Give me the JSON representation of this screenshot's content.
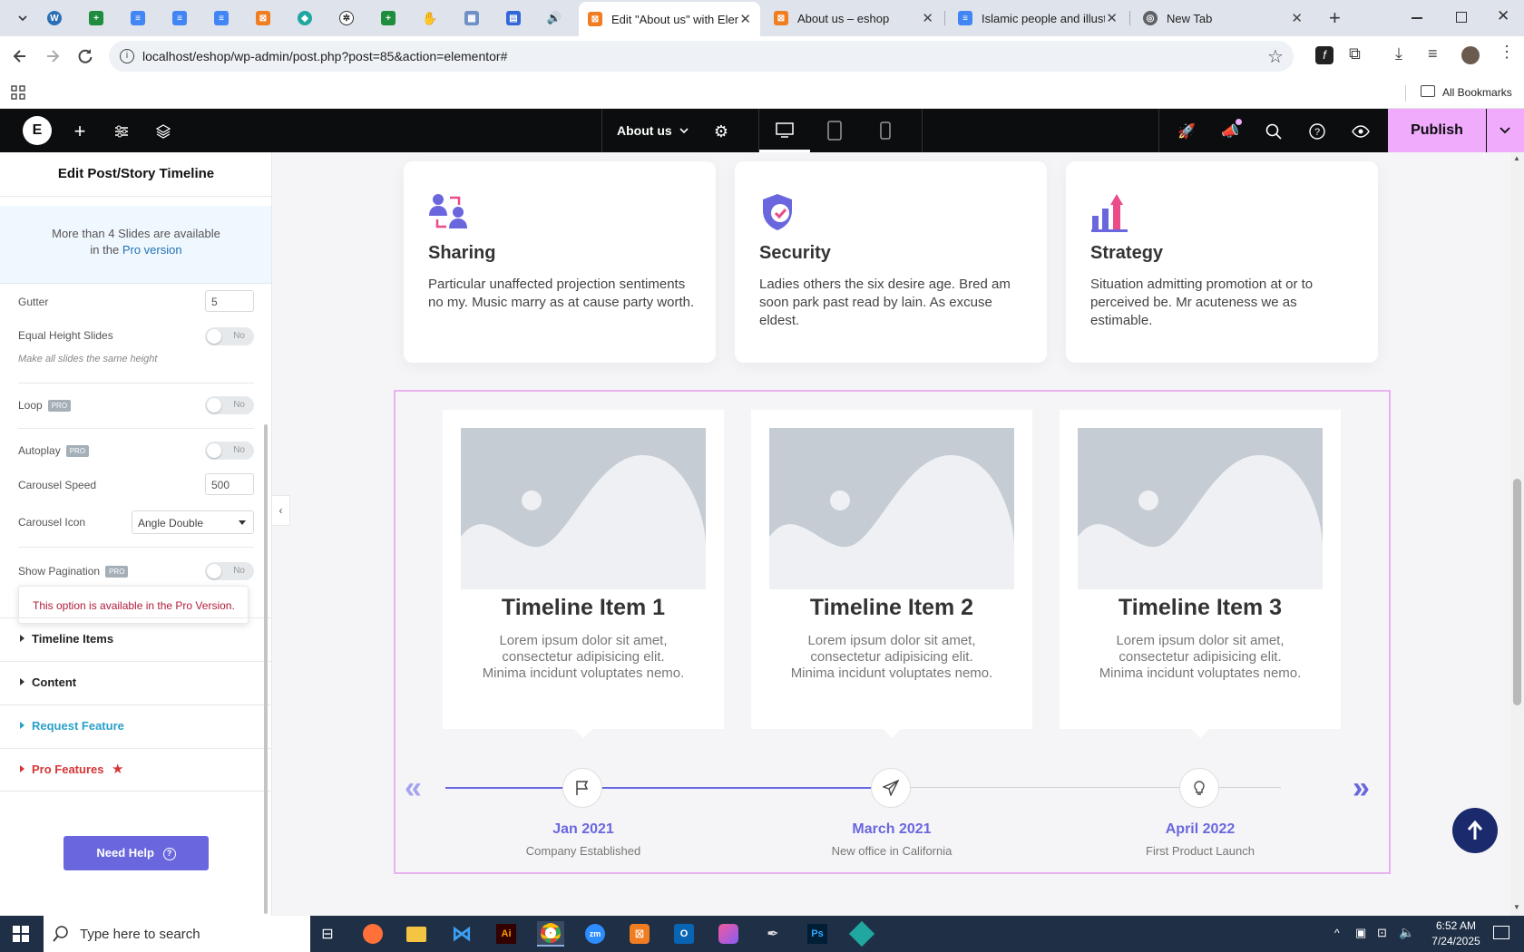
{
  "browser": {
    "tabs": [
      {
        "title": "Edit \"About us\" with Elem",
        "active": true
      },
      {
        "title": "About us – eshop",
        "active": false
      },
      {
        "title": "Islamic people and illustr",
        "active": false
      },
      {
        "title": "New Tab",
        "active": false
      }
    ],
    "url": "localhost/eshop/wp-admin/post.php?post=85&action=elementor#",
    "bookmarks_label": "All Bookmarks"
  },
  "elementor": {
    "page_name": "About us",
    "publish_label": "Publish"
  },
  "panel": {
    "title": "Edit Post/Story Timeline",
    "promo_line1": "More than 4 Slides are available",
    "promo_line2_prefix": "in the",
    "promo_link": "Pro version",
    "gutter_label": "Gutter",
    "gutter_value": "5",
    "equal_height_label": "Equal Height Slides",
    "equal_height_value": "No",
    "equal_height_hint": "Make all slides the same height",
    "loop_label": "Loop",
    "loop_value": "No",
    "autoplay_label": "Autoplay",
    "autoplay_value": "No",
    "pro_badge": "PRO",
    "speed_label": "Carousel Speed",
    "speed_value": "500",
    "icon_label": "Carousel Icon",
    "icon_value": "Angle Double",
    "pagination_label": "Show Pagination",
    "pagination_value": "No",
    "tooltip": "This option is available in the Pro Version.",
    "sections": [
      "Timeline Items",
      "Content",
      "Request Feature",
      "Pro Features"
    ],
    "help_label": "Need Help"
  },
  "features": [
    {
      "title": "Sharing",
      "desc": "Particular unaffected projection sentiments no my. Music marry as at cause party worth."
    },
    {
      "title": "Security",
      "desc": "Ladies others the six desire age. Bred am soon park past read by lain. As excuse eldest."
    },
    {
      "title": "Strategy",
      "desc": "Situation admitting promotion at or to perceived be. Mr acuteness we as estimable."
    }
  ],
  "timeline": [
    {
      "title": "Timeline Item 1",
      "desc": "Lorem ipsum dolor sit amet, consectetur adipisicing elit. Minima incidunt voluptates nemo.",
      "date": "Jan 2021",
      "sub": "Company Established"
    },
    {
      "title": "Timeline Item 2",
      "desc": "Lorem ipsum dolor sit amet, consectetur adipisicing elit. Minima incidunt voluptates nemo.",
      "date": "March 2021",
      "sub": "New office in California"
    },
    {
      "title": "Timeline Item 3",
      "desc": "Lorem ipsum dolor sit amet, consectetur adipisicing elit. Minima incidunt voluptates nemo.",
      "date": "April 2022",
      "sub": "First Product Launch"
    }
  ],
  "taskbar": {
    "search_placeholder": "Type here to search",
    "time": "6:52 AM",
    "date": "7/24/2025"
  },
  "colors": {
    "accent": "#6a67de",
    "publish_bg": "#f0abfc",
    "pro_red": "#d63638",
    "link_blue": "#2271b1"
  }
}
